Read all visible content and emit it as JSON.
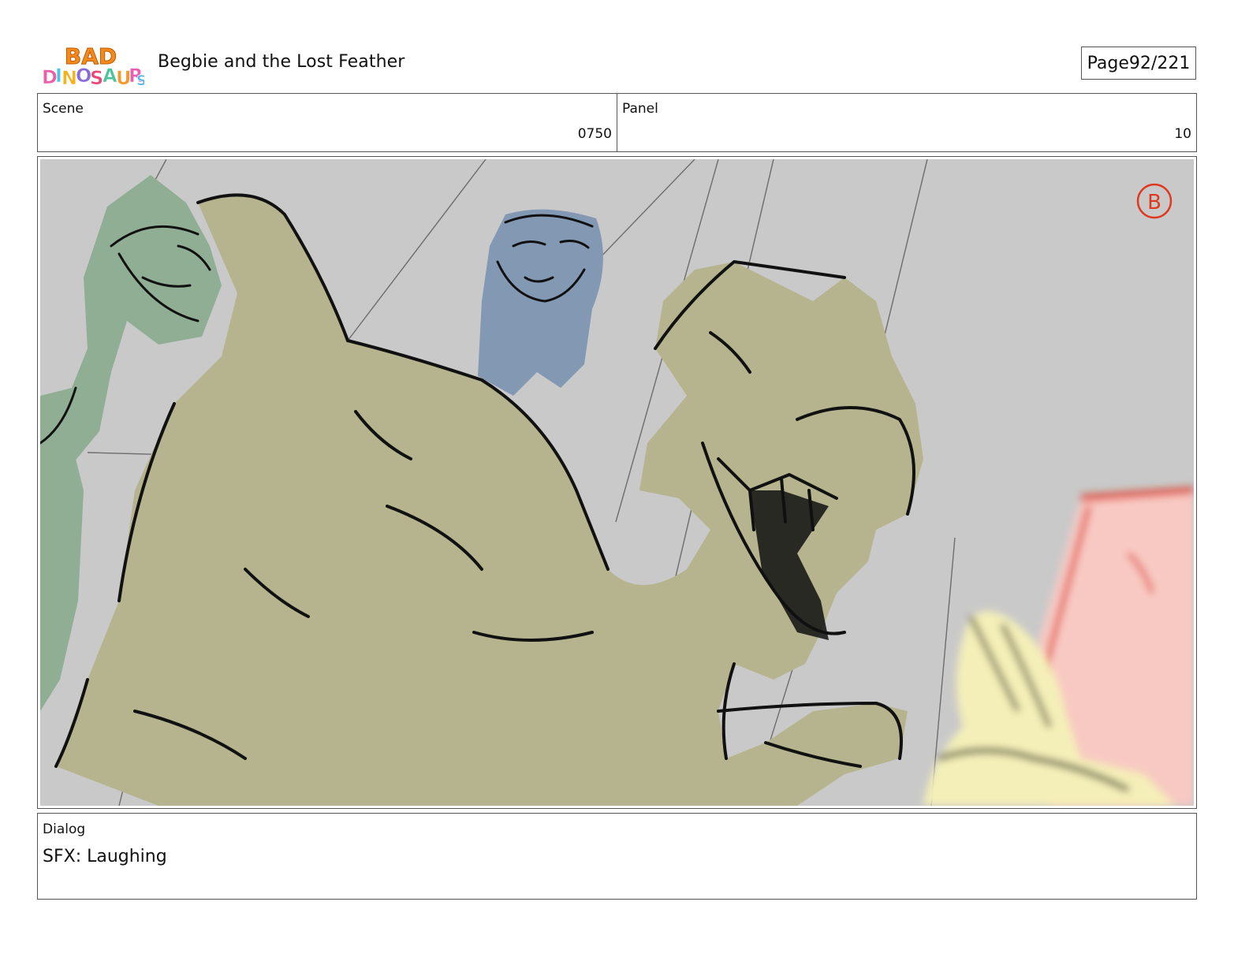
{
  "header": {
    "logo_text": "BAD DINOSAURS",
    "title": "Begbie and the Lost Feather",
    "page_label": "Page",
    "page_number": "92/221"
  },
  "info": {
    "scene_label": "Scene",
    "scene_value": "0750",
    "panel_label": "Panel",
    "panel_value": "10"
  },
  "panel_image": {
    "stamp_letter": "B",
    "colors": {
      "background": "#c9c9c9",
      "green_dino": "#8fae93",
      "blue_dino": "#8398b2",
      "tan_dino": "#b6b48f",
      "pink_block": "#f8c9c2",
      "yellow_feather": "#f4efb8",
      "red_accent": "#e0381e",
      "ink": "#111111"
    }
  },
  "dialog": {
    "label": "Dialog",
    "text": "SFX: Laughing"
  }
}
